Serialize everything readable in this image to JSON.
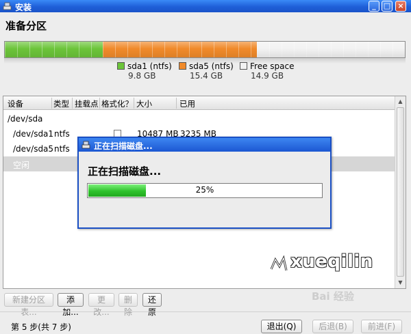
{
  "window": {
    "title": "安装",
    "min_glyph": "_",
    "max_glyph": "□",
    "close_glyph": "×"
  },
  "page": {
    "heading": "准备分区"
  },
  "partition_bar": {
    "segments": [
      {
        "name": "sda1 (ntfs)",
        "size": "9.8 GB",
        "color": "#6cc43a",
        "fraction": 0.245
      },
      {
        "name": "sda5 (ntfs)",
        "size": "15.4 GB",
        "color": "#f08a2a",
        "fraction": 0.385
      },
      {
        "name": "Free space",
        "size": "14.9 GB",
        "color": "#f2f2f2",
        "fraction": 0.37
      }
    ]
  },
  "table": {
    "headers": [
      "设备",
      "类型",
      "挂载点",
      "格式化？",
      "大小",
      "已用"
    ],
    "rows": [
      {
        "device": "/dev/sda",
        "type": "",
        "mount": "",
        "size": "",
        "used": ""
      },
      {
        "device": "/dev/sda1",
        "type": "ntfs",
        "mount": "",
        "size": "10487 MB",
        "used": "3235 MB"
      },
      {
        "device": "/dev/sda5",
        "type": "ntfs",
        "mount": "",
        "size": "",
        "used": ""
      },
      {
        "device": "空闲",
        "type": "",
        "mount": "",
        "size": "",
        "used": ""
      }
    ]
  },
  "actions": {
    "new_table": "新建分区表...",
    "add": "添加...",
    "change": "更改...",
    "delete": "删除",
    "revert": "还原"
  },
  "footer": {
    "step": "第 5 步(共 7 步)",
    "quit": "退出(Q)",
    "back": "后退(B)",
    "forward": "前进(F)"
  },
  "dialog": {
    "title": "正在扫描磁盘...",
    "message": "正在扫描磁盘...",
    "progress": 0.25,
    "progress_label": "25%"
  },
  "watermark": {
    "text": "xueqilin",
    "baidu": "Bai 经验"
  }
}
